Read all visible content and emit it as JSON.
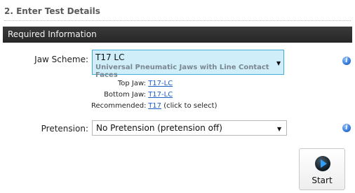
{
  "section_title": "2. Enter Test Details",
  "panel_header": "Required Information",
  "jaw": {
    "label": "Jaw Scheme:",
    "selected_code": "T17 LC",
    "selected_desc": "Universal Pneumatic Jaws with Line Contact Faces",
    "top_jaw_label": "Top Jaw:",
    "top_jaw_value": "T17-LC",
    "bottom_jaw_label": "Bottom Jaw:",
    "bottom_jaw_value": "T17-LC",
    "recommended_label": "Recommended:",
    "recommended_value": "T17",
    "recommended_hint": "(click to select)"
  },
  "pretension": {
    "label": "Pretension:",
    "selected": "No Pretension (pretension off)"
  },
  "start_button": {
    "label": "Start"
  },
  "icons": {
    "info": "info-icon",
    "dropdown": "chevron-down-icon",
    "play": "play-icon"
  },
  "colors": {
    "header_bar": "#2b2b2b",
    "jaw_select_bg": "#cfeef9",
    "jaw_select_border": "#3fb0d9",
    "link": "#1a5fc4"
  }
}
